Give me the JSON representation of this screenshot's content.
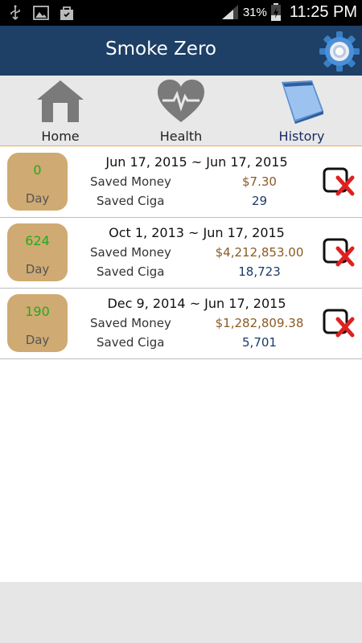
{
  "status_bar": {
    "battery_percent": "31%",
    "time": "11:25 PM"
  },
  "header": {
    "title": "Smoke Zero"
  },
  "tabs": [
    {
      "label": "Home",
      "icon": "house-icon",
      "active": false
    },
    {
      "label": "Health",
      "icon": "heart-pulse-icon",
      "active": true
    },
    {
      "label": "History",
      "icon": "notebook-icon",
      "active": true
    }
  ],
  "history": {
    "money_label": "Saved Money",
    "ciga_label": "Saved Ciga",
    "day_unit": "Day",
    "rows": [
      {
        "days": "0",
        "date_range": "Jun 17, 2015 ~ Jun 17, 2015",
        "saved_money": "$7.30",
        "saved_ciga": "29"
      },
      {
        "days": "624",
        "date_range": "Oct 1, 2013 ~ Jun 17, 2015",
        "saved_money": "$4,212,853.00",
        "saved_ciga": "18,723"
      },
      {
        "days": "190",
        "date_range": "Dec 9, 2014 ~ Jun 17, 2015",
        "saved_money": "$1,282,809.38",
        "saved_ciga": "5,701"
      }
    ]
  },
  "colors": {
    "header_bg": "#1e3f66",
    "badge_bg": "#cfaa72",
    "day_count": "#22aa22",
    "money_value": "#8a5a22",
    "ciga_value": "#1a3a6a",
    "delete_x": "#e02020"
  }
}
